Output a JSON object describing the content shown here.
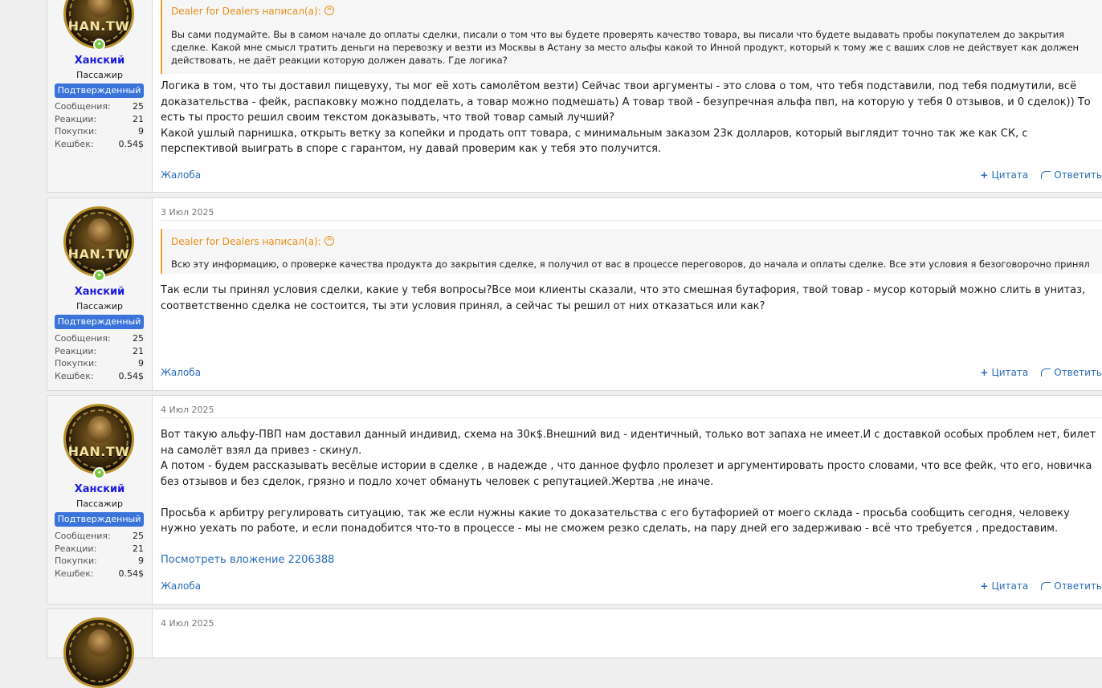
{
  "posts": [
    {
      "user": {
        "name": "Ханский",
        "title": "Пассажир",
        "banner": "Подтвержденный",
        "avatar_text": "HAN.TW",
        "stats": [
          {
            "label": "Сообщения:",
            "value": "25"
          },
          {
            "label": "Реакции:",
            "value": "21"
          },
          {
            "label": "Покупки:",
            "value": "9"
          },
          {
            "label": "Кешбек:",
            "value": "0.54$"
          }
        ]
      },
      "quote": {
        "author": "Dealer for Dealers написал(а):",
        "text": "Вы сами подумайте. Вы в самом начале до оплаты сделки, писали о том что вы будете проверять качество товара, вы писали что будете выдавать пробы покупателем до закрытия сделке. Какой мне смысл тратить деньги на перевозку и везти из Москвы в Астану за место альфы какой то Инной продукт, который к тому же с ваших слов не действует как должен действовать, не даёт реакции которую должен давать. Где логика?"
      },
      "message": "Логика в том, что ты доставил пищевуху, ты мог её хоть самолётом везти) Сейчас твои аргументы - это слова о том, что тебя подставили, под тебя подмутили, всё доказательства - фейк, распаковку можно подделать, а товар можно подмешать) А товар твой - безупречная альфа пвп, на которую у тебя 0 отзывов, и 0 сделок)) То есть ты просто решил своим текстом доказывать, что твой товар самый лучший?\nКакой ушлый парнишка, открыть ветку за копейки и продать опт товара, с минимальным заказом 23к долларов, который выглядит точно так же как СК, с перспективой выиграть в споре с гарантом, ну давай проверим как у тебя это получится.",
      "report": "Жалоба",
      "quote_btn": "Цитата",
      "reply_btn": "Ответить"
    },
    {
      "date": "3 Июл 2025",
      "user": {
        "name": "Ханский",
        "title": "Пассажир",
        "banner": "Подтвержденный",
        "avatar_text": "HAN.TW",
        "stats": [
          {
            "label": "Сообщения:",
            "value": "25"
          },
          {
            "label": "Реакции:",
            "value": "21"
          },
          {
            "label": "Покупки:",
            "value": "9"
          },
          {
            "label": "Кешбек:",
            "value": "0.54$"
          }
        ]
      },
      "quote": {
        "author": "Dealer for Dealers написал(а):",
        "text": "Всю эту информацию, о проверке качества продукта до закрытия сделке, я получил от вас в процессе переговоров, до начала и оплаты сделке. Все эти условия я безоговорочно принял"
      },
      "message": "Так если ты принял условия сделки, какие у тебя вопросы?Все мои клиенты сказали, что это смешная бутафория, твой товар - мусор который можно слить в унитаз, соответственно сделка не состоится, ты эти условия принял, а сейчас ты решил от них отказаться или как?",
      "report": "Жалоба",
      "quote_btn": "Цитата",
      "reply_btn": "Ответить"
    },
    {
      "date": "4 Июл 2025",
      "user": {
        "name": "Ханский",
        "title": "Пассажир",
        "banner": "Подтвержденный",
        "avatar_text": "HAN.TW",
        "stats": [
          {
            "label": "Сообщения:",
            "value": "25"
          },
          {
            "label": "Реакции:",
            "value": "21"
          },
          {
            "label": "Покупки:",
            "value": "9"
          },
          {
            "label": "Кешбек:",
            "value": "0.54$"
          }
        ]
      },
      "message": "Вот такую альфу-ПВП нам доставил данный индивид, схема на 30к$.Внешний вид - идентичный, только вот запаха не имеет.И с доставкой особых проблем нет, билет на самолёт взял да привез - скинул.\nА потом - будем рассказывать весёлые истории в сделке , в надежде , что данное фуфло пролезет и аргументировать просто словами, что все фейк, что его, новичка без отзывов и без сделок, грязно и подло хочет обмануть человек с репутацией.Жертва ,не иначе.\n\nПросьба к арбитру регулировать ситуацию, так же если нужны какие то доказательства с его бутафорией от моего склада - просьба сообщить сегодня, человеку нужно уехать по работе, и если понадобится что-то в процессе - мы не сможем резко сделать, на пару дней его задерживаю - всё что требуется , предоставим.",
      "attachment": "Посмотреть вложение 2206388",
      "report": "Жалоба",
      "quote_btn": "Цитата",
      "reply_btn": "Ответить"
    },
    {
      "date": "4 Июл 2025"
    }
  ]
}
